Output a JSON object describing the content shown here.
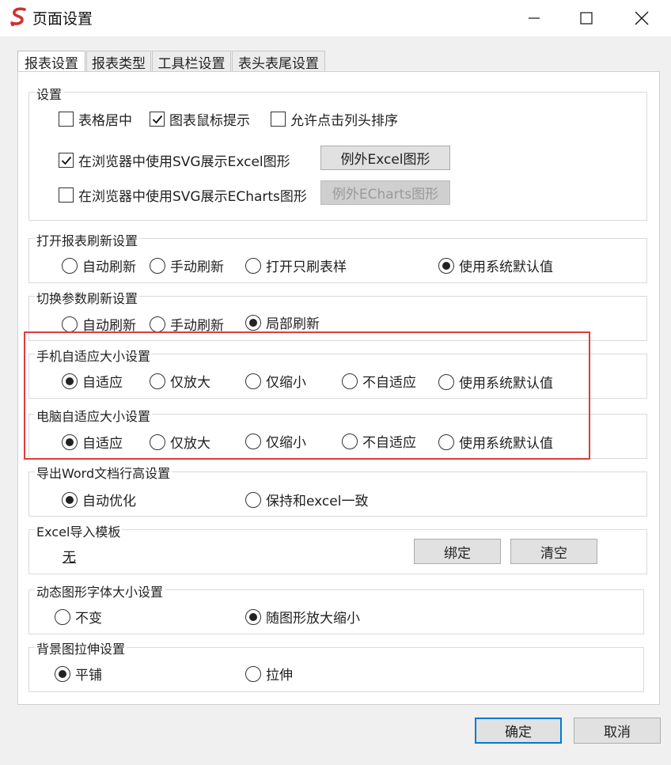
{
  "window": {
    "title": "页面设置",
    "icons": [
      "app-logo-icon",
      "minimize-icon",
      "maximize-icon",
      "close-icon"
    ],
    "accent_color": "#e03c3c"
  },
  "tabs": [
    {
      "label": "报表设置",
      "active": true
    },
    {
      "label": "报表类型",
      "active": false
    },
    {
      "label": "工具栏设置",
      "active": false
    },
    {
      "label": "表头表尾设置",
      "active": false
    }
  ],
  "settings": {
    "legend": "设置",
    "center_table": {
      "label": "表格居中",
      "checked": false
    },
    "chart_tooltip": {
      "label": "图表鼠标提示",
      "checked": true
    },
    "click_sort": {
      "label": "允许点击列头排序",
      "checked": false
    },
    "svg_excel": {
      "label": "在浏览器中使用SVG展示Excel图形",
      "checked": true
    },
    "svg_echarts": {
      "label": "在浏览器中使用SVG展示ECharts图形",
      "checked": false
    },
    "except_excel_button": "例外Excel图形",
    "except_echarts_button": "例外ECharts图形"
  },
  "open_refresh": {
    "legend": "打开报表刷新设置",
    "options": [
      "自动刷新",
      "手动刷新",
      "打开只刷表样",
      "使用系统默认值"
    ],
    "selected": 3
  },
  "param_refresh": {
    "legend": "切换参数刷新设置",
    "options": [
      "自动刷新",
      "手动刷新",
      "局部刷新"
    ],
    "selected": 2
  },
  "mobile_adapt": {
    "legend": "手机自适应大小设置",
    "options": [
      "自适应",
      "仅放大",
      "仅缩小",
      "不自适应",
      "使用系统默认值"
    ],
    "selected": 0
  },
  "pc_adapt": {
    "legend": "电脑自适应大小设置",
    "options": [
      "自适应",
      "仅放大",
      "仅缩小",
      "不自适应",
      "使用系统默认值"
    ],
    "selected": 0
  },
  "word_export": {
    "legend": "导出Word文档行高设置",
    "options": [
      "自动优化",
      "保持和excel一致"
    ],
    "selected": 0
  },
  "excel_import": {
    "legend": "Excel导入模板",
    "value": "无",
    "bind_button": "绑定",
    "clear_button": "清空"
  },
  "chart_font": {
    "legend": "动态图形字体大小设置",
    "options": [
      "不变",
      "随图形放大缩小"
    ],
    "selected": 1
  },
  "bg_stretch": {
    "legend": "背景图拉伸设置",
    "options": [
      "平铺",
      "拉伸"
    ],
    "selected": 0
  },
  "footer": {
    "ok_button": "确定",
    "cancel_button": "取消"
  }
}
